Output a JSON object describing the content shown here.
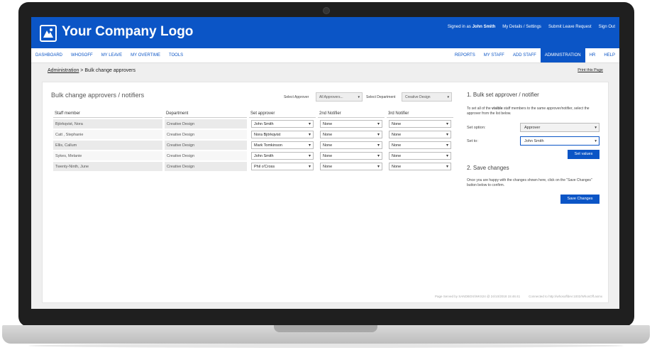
{
  "header": {
    "logo_text": "Your Company Logo",
    "signed_in_prefix": "Signed in as",
    "signed_in_user": "John Smith",
    "links": [
      "My Details / Settings",
      "Submit Leave Request",
      "Sign Out"
    ]
  },
  "nav_left": [
    "DASHBOARD",
    "WHOSOFF",
    "MY LEAVE",
    "MY OVERTIME",
    "TOOLS"
  ],
  "nav_right": [
    {
      "label": "REPORTS",
      "active": false
    },
    {
      "label": "MY STAFF",
      "active": false
    },
    {
      "label": "ADD STAFF",
      "active": false
    },
    {
      "label": "ADMINISTRATION",
      "active": true
    },
    {
      "label": "HR",
      "active": false
    },
    {
      "label": "HELP",
      "active": false
    }
  ],
  "breadcrumb": {
    "root": "Administration",
    "separator": " > ",
    "current": "Bulk change approvers"
  },
  "print_label": "Print this Page",
  "main": {
    "title": "Bulk change approvers / notifiers",
    "filter_approver_label": "Select Approver",
    "filter_approver_value": "All Approvers...",
    "filter_department_label": "Select Department",
    "filter_department_value": "Creative Design",
    "columns": [
      "Staff member",
      "Department",
      "Set approver",
      "2nd Notifier",
      "3rd Notifier"
    ],
    "rows": [
      {
        "name": "Björkqvist, Nora",
        "department": "Creative Design",
        "approver": "John Smith",
        "n2": "None",
        "n3": "None"
      },
      {
        "name": "Catt , Stephanie",
        "department": "Creative Design",
        "approver": "Nora Björkqvist",
        "n2": "None",
        "n3": "None"
      },
      {
        "name": "Ellis, Callum",
        "department": "Creative Design",
        "approver": "Mark Tomkinson",
        "n2": "None",
        "n3": "None"
      },
      {
        "name": "Sykes, Melanie",
        "department": "Creative Design",
        "approver": "John Smith",
        "n2": "None",
        "n3": "None"
      },
      {
        "name": "Twenty-Ninth, June",
        "department": "Creative Design",
        "approver": "Phil o'Cross",
        "n2": "None",
        "n3": "None"
      }
    ]
  },
  "side": {
    "section1_title": "1. Bulk set approver / notifier",
    "section1_text_a": "To set all of the",
    "section1_text_bold": "visible",
    "section1_text_b": "staff members to the same approver/notifier, select the approver from the list below.",
    "set_option_label": "Set option:",
    "set_option_value": "Approver",
    "set_to_label": "Set to:",
    "set_to_value": "John Smith",
    "set_values_button": "Set values",
    "section2_title": "2. Save changes",
    "section2_text": "Once you are happy with the changes shown here, click on the \"Save Changes\" button below to confirm.",
    "save_button": "Save Changes"
  },
  "footer": {
    "served": "Page Served by SANDBOX/WKS24 @ 24/10/2018 15:46:41",
    "connected": "Connected to http://whosoffdev:1002/WhosOff.asmx"
  },
  "colors": {
    "brand": "#0b55c6"
  }
}
